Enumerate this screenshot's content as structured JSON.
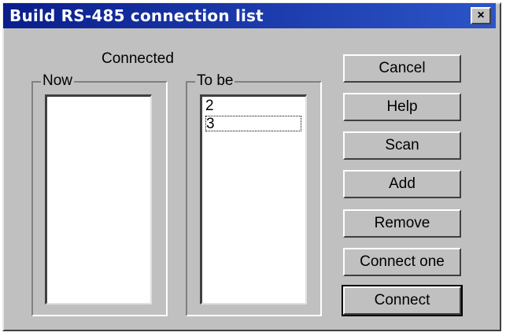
{
  "window": {
    "title": "Build RS-485 connection list",
    "close_glyph": "×"
  },
  "connected_label": "Connected",
  "groups": {
    "now": {
      "legend": "Now",
      "items": []
    },
    "to_be": {
      "legend": "To be",
      "items": [
        "2",
        "3"
      ],
      "focused_index": 1
    }
  },
  "buttons": [
    {
      "label": "Cancel"
    },
    {
      "label": "Help"
    },
    {
      "label": "Scan"
    },
    {
      "label": "Add"
    },
    {
      "label": "Remove"
    },
    {
      "label": "Connect one"
    },
    {
      "label": "Connect",
      "default": true
    }
  ]
}
